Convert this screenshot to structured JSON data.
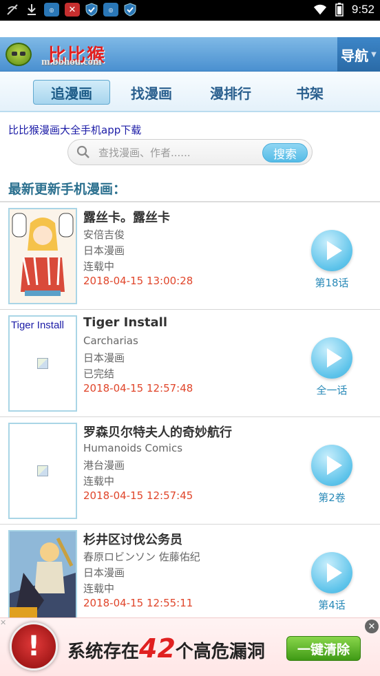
{
  "status_bar": {
    "time": "9:52",
    "left_icons": [
      "wifi-off-icon",
      "download-icon",
      "app-badge-icon",
      "x-badge-icon",
      "shield-icon",
      "app-badge-icon",
      "shield-icon"
    ]
  },
  "header": {
    "logo_text": "比比猴",
    "logo_url": "m.bbhou.com",
    "nav_label": "导航"
  },
  "tabs": [
    {
      "label": "追漫画",
      "active": true
    },
    {
      "label": "找漫画",
      "active": false
    },
    {
      "label": "漫排行",
      "active": false
    },
    {
      "label": "书架",
      "active": false
    }
  ],
  "app_link": "比比猴漫画大全手机app下载",
  "search": {
    "placeholder": "查找漫画、作者......",
    "button": "搜索"
  },
  "section_title": "最新更新手机漫画：",
  "comics": [
    {
      "title": "露丝卡。露丝卡",
      "author": "安倍吉俊",
      "region": "日本漫画",
      "status": "连载中",
      "updated": "2018-04-15 13:00:28",
      "episode": "第18话",
      "cover_alt": ""
    },
    {
      "title": "Tiger Install",
      "author": "Carcharias",
      "region": "日本漫画",
      "status": "已完结",
      "updated": "2018-04-15 12:57:48",
      "episode": "全一话",
      "cover_alt": "Tiger Install"
    },
    {
      "title": "罗森贝尔特夫人的奇妙航行",
      "author": "Humanoids Comics",
      "region": "港台漫画",
      "status": "连载中",
      "updated": "2018-04-15 12:57:45",
      "episode": "第2卷",
      "cover_alt": ""
    },
    {
      "title": "杉井区讨伐公务员",
      "author": "春原ロビンソン 佐藤佑纪",
      "region": "日本漫画",
      "status": "连载中",
      "updated": "2018-04-15 12:55:11",
      "episode": "第4话",
      "cover_alt": ""
    }
  ],
  "ad": {
    "text_before": "系统存在",
    "number": "42",
    "text_after": "个高危漏洞",
    "button": "一键清除"
  },
  "colors": {
    "header_blue": "#4a90d0",
    "tab_text": "#2a5f8e",
    "date_red": "#e0452a",
    "episode_blue": "#2a8ab8",
    "ad_button_green": "#3f9a15"
  }
}
